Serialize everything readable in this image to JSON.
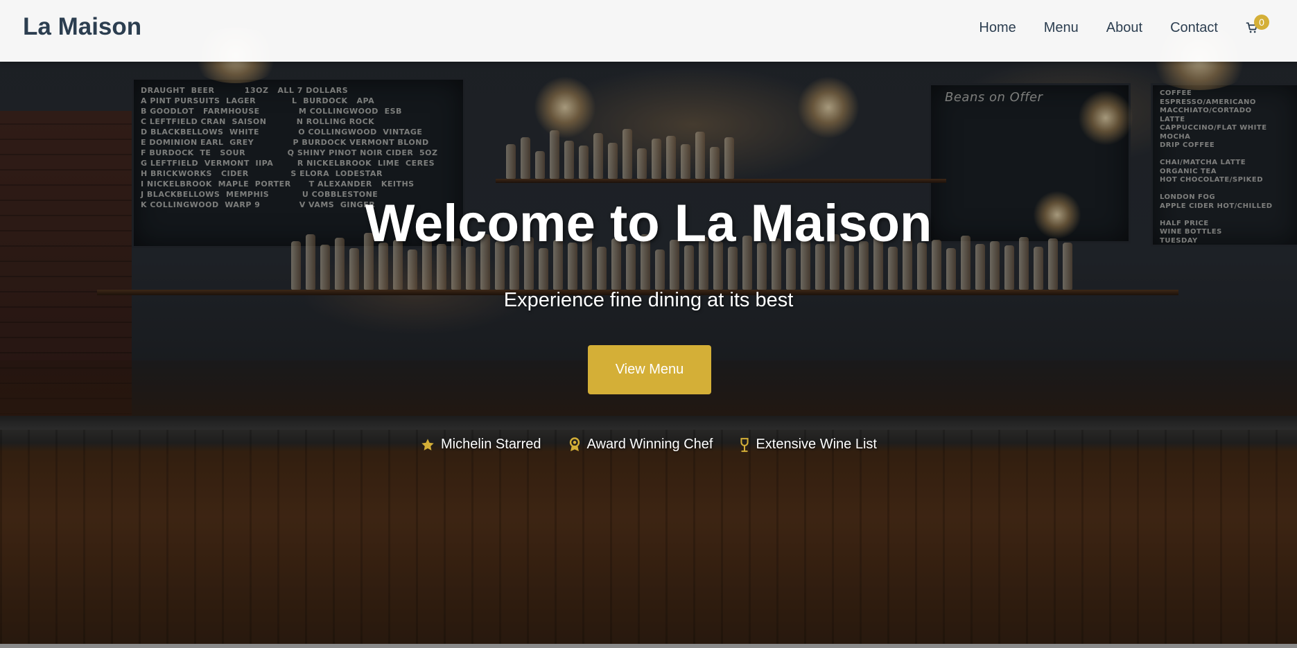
{
  "navbar": {
    "brand": "La Maison",
    "links": [
      {
        "label": "Home"
      },
      {
        "label": "Menu"
      },
      {
        "label": "About"
      },
      {
        "label": "Contact"
      }
    ],
    "cart": {
      "icon": "cart-icon",
      "count": "0"
    }
  },
  "hero": {
    "title": "Welcome to La Maison",
    "subtitle": "Experience fine dining at its best",
    "cta_label": "View Menu",
    "features": [
      {
        "icon": "star-icon",
        "label": "Michelin Starred"
      },
      {
        "icon": "award-icon",
        "label": "Award Winning Chef"
      },
      {
        "icon": "wine-glass-icon",
        "label": "Extensive Wine List"
      }
    ]
  },
  "background": {
    "chalkboard_beer": "DRAUGHT  BEER          13OZ   ALL 7 DOLLARS\nA PINT PURSUITS  LAGER            L  BURDOCK   APA\nB GOODLOT   FARMHOUSE             M COLLINGWOOD  ESB\nC LEFTFIELD CRAN  SAISON          N ROLLING ROCK\nD BLACKBELLOWS  WHITE             O COLLINGWOOD  VINTAGE\nE DOMINION EARL  GREY             P BURDOCK VERMONT BLOND\nF BURDOCK  TE   SOUR              Q SHINY PINOT NOIR CIDER  5OZ\nG LEFTFIELD  VERMONT  IIPA        R NICKELBROOK  LIME  CERES\nH BRICKWORKS   CIDER              S ELORA  LODESTAR\nI NICKELBROOK  MAPLE  PORTER      T ALEXANDER   KEITHS\nJ BLACKBELLOWS  MEMPHIS           U COBBLESTONE\nK COLLINGWOOD  WARP 9             V VAMS  GINGER",
    "chalkboard_beans": "Beans on Offer",
    "chalkboard_coffee": "COFFEE\nESPRESSO/AMERICANO\nMACCHIATO/CORTADO\nLATTE\nCAPPUCCINO/FLAT WHITE\nMOCHA\nDRIP COFFEE\n\nCHAI/MATCHA LATTE\nORGANIC TEA\nHOT CHOCOLATE/SPIKED\n\nLONDON FOG\nAPPLE CIDER HOT/CHILLED\n\nHALF PRICE\nWINE BOTTLES\nTUESDAY",
    "colors": {
      "accent": "#d4af37",
      "brand_text": "#2c3e50"
    }
  }
}
